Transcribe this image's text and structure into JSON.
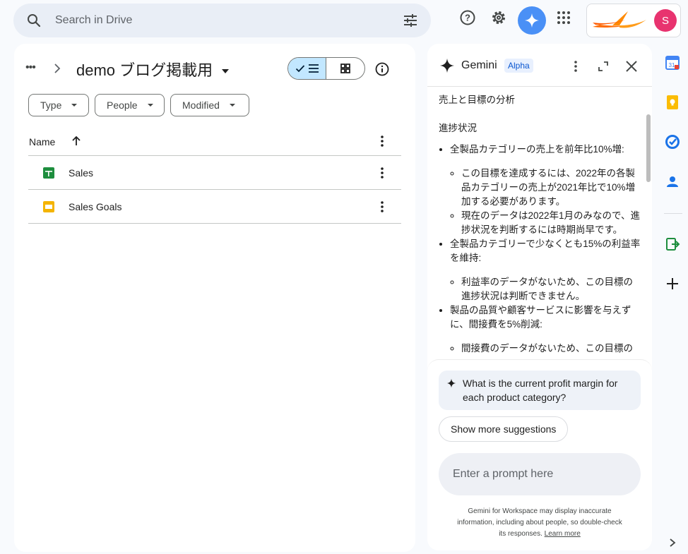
{
  "search": {
    "placeholder": "Search in Drive"
  },
  "header": {
    "account_initial": "S"
  },
  "folder": {
    "breadcrumb_more": "•••",
    "title": "demo ブログ掲載用"
  },
  "filters": [
    {
      "label": "Type"
    },
    {
      "label": "People"
    },
    {
      "label": "Modified"
    }
  ],
  "table": {
    "column_name": "Name",
    "sort_direction": "ascending"
  },
  "files": [
    {
      "name": "Sales",
      "icon": "sheets-icon",
      "color": "#1e8e3e"
    },
    {
      "name": "Sales Goals",
      "icon": "slides-icon",
      "color": "#f4b400"
    }
  ],
  "gemini": {
    "title": "Gemini",
    "badge": "Alpha",
    "heading": "売上と目標の分析",
    "subheading": "進捗状況",
    "goals": [
      {
        "text": "全製品カテゴリーの売上を前年比10%増:",
        "points": [
          "この目標を達成するには、2022年の各製品カテゴリーの売上が2021年比で10%増加する必要があります。",
          "現在のデータは2022年1月のみなので、進捗状況を判断するには時期尚早です。"
        ]
      },
      {
        "text": "全製品カテゴリーで少なくとも15%の利益率を維持:",
        "points": [
          "利益率のデータがないため、この目標の進捗状況は判断できません。"
        ]
      },
      {
        "text": "製品の品質や顧客サービスに影響を与えずに、間接費を5%削減:",
        "points": [
          "間接費のデータがないため、この目標の"
        ]
      }
    ],
    "suggestion": "What is the current profit margin for each product category?",
    "more_suggestions": "Show more suggestions",
    "prompt_placeholder": "Enter a prompt here",
    "disclaimer": "Gemini for Workspace may display inaccurate information, including about people, so double-check its responses.",
    "learn_more": "Learn more"
  },
  "colors": {
    "accent": "#0b57d0",
    "gemini_button": "#4a90f6",
    "avatar": "#e8336f",
    "selected_view": "#c2e7ff"
  }
}
